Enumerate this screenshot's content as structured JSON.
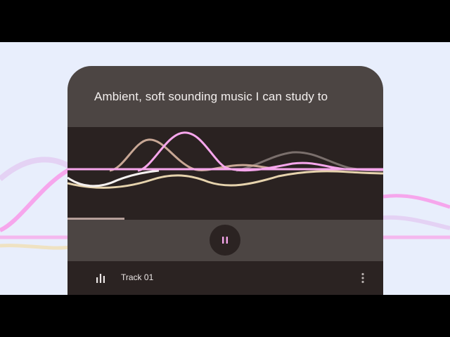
{
  "prompt": {
    "text": "Ambient, soft sounding music I can study to"
  },
  "player": {
    "state": "playing",
    "control_icon": "pause-icon",
    "progress_fraction": 0.18
  },
  "track": {
    "name": "Track 01",
    "icon": "equalizer-bars-icon",
    "menu_icon": "more-vert-icon"
  },
  "colors": {
    "background": "#e8eefc",
    "card": "#4c4543",
    "visualizer_bg": "#2a2221",
    "accent_pink": "#f6a6ec",
    "wave_tan": "#c8a795",
    "wave_cream": "#e6d3ad",
    "wave_gray": "#7a6f6c"
  }
}
